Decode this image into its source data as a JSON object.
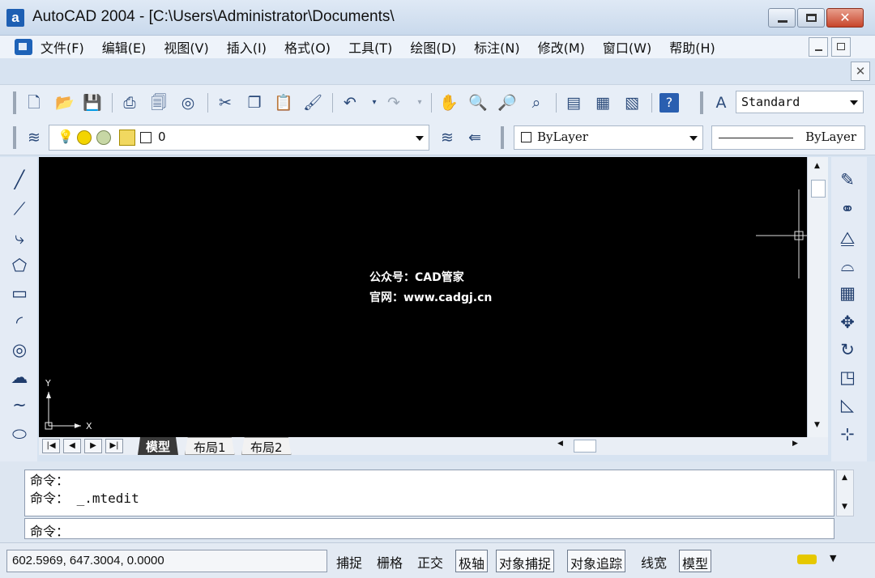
{
  "title": "AutoCAD 2004 - [C:\\Users\\Administrator\\Documents\\",
  "app_icon_letter": "a",
  "menu": [
    "文件(F)",
    "编辑(E)",
    "视图(V)",
    "插入(I)",
    "格式(O)",
    "工具(T)",
    "绘图(D)",
    "标注(N)",
    "修改(M)",
    "窗口(W)",
    "帮助(H)"
  ],
  "toolbar": {
    "text_style": "Standard",
    "layer": "0",
    "color": "ByLayer",
    "linetype": "ByLayer"
  },
  "canvas": {
    "watermark_line1": "公众号：CAD管家",
    "watermark_line2": "官网：www.cadgj.cn",
    "ucs_x": "X",
    "ucs_y": "Y",
    "background": "#000000"
  },
  "tabs": [
    "模型",
    "布局1",
    "布局2"
  ],
  "command": {
    "history": [
      "命令：",
      "命令： _.mtedit"
    ],
    "prompt": "命令："
  },
  "status": {
    "coords": "602.5969, 647.3004, 0.0000",
    "buttons": [
      "捕捉",
      "栅格",
      "正交",
      "极轴",
      "对象捕捉",
      "对象追踪",
      "线宽",
      "模型"
    ]
  },
  "colors": {
    "title_bg": "#c9d9ec",
    "close_button": "#c7452b",
    "accent": "#1d5fb3"
  }
}
